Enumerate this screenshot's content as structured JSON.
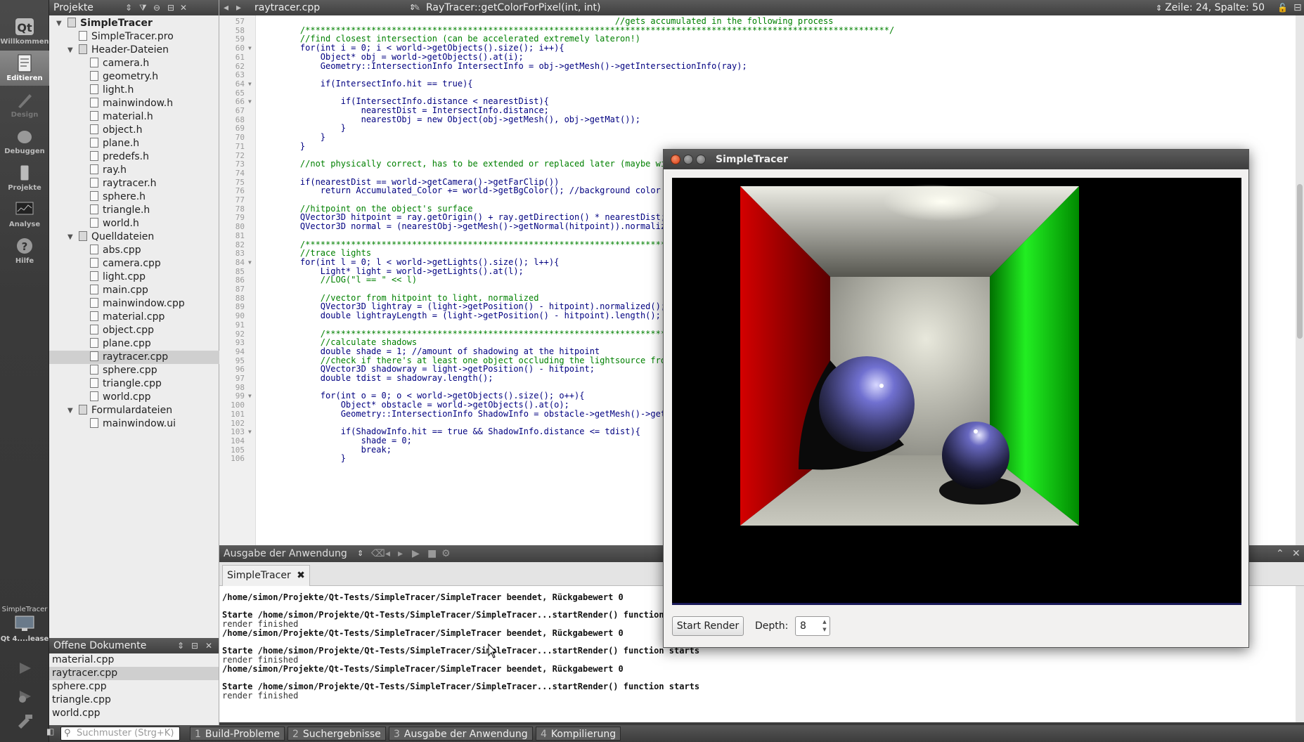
{
  "modes": [
    {
      "label": "Willkommen",
      "icon": "qt-logo-icon"
    },
    {
      "label": "Editieren",
      "icon": "edit-document-icon"
    },
    {
      "label": "Design",
      "icon": "design-pen-icon"
    },
    {
      "label": "Debuggen",
      "icon": "bug-icon"
    },
    {
      "label": "Projekte",
      "icon": "wrench-icon"
    },
    {
      "label": "Analyse",
      "icon": "monitor-icon"
    },
    {
      "label": "Hilfe",
      "icon": "help-icon"
    }
  ],
  "kit": {
    "project": "SimpleTracer",
    "label": "Qt 4....lease"
  },
  "projects_panel": {
    "title": "Projekte",
    "tree": [
      {
        "label": "SimpleTracer",
        "level": 0,
        "expanded": true,
        "bold": true
      },
      {
        "label": "SimpleTracer.pro",
        "level": 1
      },
      {
        "label": "Header-Dateien",
        "level": 1,
        "expanded": true
      },
      {
        "label": "camera.h",
        "level": 2
      },
      {
        "label": "geometry.h",
        "level": 2
      },
      {
        "label": "light.h",
        "level": 2
      },
      {
        "label": "mainwindow.h",
        "level": 2
      },
      {
        "label": "material.h",
        "level": 2
      },
      {
        "label": "object.h",
        "level": 2
      },
      {
        "label": "plane.h",
        "level": 2
      },
      {
        "label": "predefs.h",
        "level": 2
      },
      {
        "label": "ray.h",
        "level": 2
      },
      {
        "label": "raytracer.h",
        "level": 2
      },
      {
        "label": "sphere.h",
        "level": 2
      },
      {
        "label": "triangle.h",
        "level": 2
      },
      {
        "label": "world.h",
        "level": 2
      },
      {
        "label": "Quelldateien",
        "level": 1,
        "expanded": true
      },
      {
        "label": "abs.cpp",
        "level": 2
      },
      {
        "label": "camera.cpp",
        "level": 2
      },
      {
        "label": "light.cpp",
        "level": 2
      },
      {
        "label": "main.cpp",
        "level": 2
      },
      {
        "label": "mainwindow.cpp",
        "level": 2
      },
      {
        "label": "material.cpp",
        "level": 2
      },
      {
        "label": "object.cpp",
        "level": 2
      },
      {
        "label": "plane.cpp",
        "level": 2
      },
      {
        "label": "raytracer.cpp",
        "level": 2,
        "selected": true
      },
      {
        "label": "sphere.cpp",
        "level": 2
      },
      {
        "label": "triangle.cpp",
        "level": 2
      },
      {
        "label": "world.cpp",
        "level": 2
      },
      {
        "label": "Formulardateien",
        "level": 1,
        "expanded": true
      },
      {
        "label": "mainwindow.ui",
        "level": 2
      }
    ]
  },
  "open_docs": {
    "title": "Offene Dokumente",
    "items": [
      "material.cpp",
      "raytracer.cpp",
      "sphere.cpp",
      "triangle.cpp",
      "world.cpp"
    ],
    "selected": "raytracer.cpp"
  },
  "editor": {
    "file": "raytracer.cpp",
    "function": "RayTracer::getColorForPixel(int, int)",
    "position": "Zeile: 24, Spalte: 50",
    "lines": [
      {
        "n": "57",
        "t": "                                                                  //gets accumulated in the following process",
        "c": 1
      },
      {
        "n": "58",
        "t": "    /*******************************************************************************************************************/",
        "c": 1
      },
      {
        "n": "59",
        "t": "    //find closest intersection (can be accelerated extremely lateron!)",
        "c": 1
      },
      {
        "n": "60",
        "t": "    for(int i = 0; i < world->getObjects().size(); i++){",
        "f": 1
      },
      {
        "n": "61",
        "t": "        Object* obj = world->getObjects().at(i);"
      },
      {
        "n": "62",
        "t": "        Geometry::IntersectionInfo IntersectInfo = obj->getMesh()->getIntersectionInfo(ray);"
      },
      {
        "n": "63",
        "t": ""
      },
      {
        "n": "64",
        "t": "        if(IntersectInfo.hit == true){",
        "f": 1
      },
      {
        "n": "65",
        "t": ""
      },
      {
        "n": "66",
        "t": "            if(IntersectInfo.distance < nearestDist){",
        "f": 1
      },
      {
        "n": "67",
        "t": "                nearestDist = IntersectInfo.distance;"
      },
      {
        "n": "68",
        "t": "                nearestObj = new Object(obj->getMesh(), obj->getMat());"
      },
      {
        "n": "69",
        "t": "            }"
      },
      {
        "n": "70",
        "t": "        }"
      },
      {
        "n": "71",
        "t": "    }"
      },
      {
        "n": "72",
        "t": ""
      },
      {
        "n": "73",
        "t": "    //not physically correct, has to be extended or replaced later (maybe with c",
        "c": 1
      },
      {
        "n": "74",
        "t": ""
      },
      {
        "n": "75",
        "t": "    if(nearestDist == world->getCamera()->getFarClip())"
      },
      {
        "n": "76",
        "t": "        return Accumulated_Color += world->getBgColor(); //background color"
      },
      {
        "n": "77",
        "t": ""
      },
      {
        "n": "78",
        "t": "    //hitpoint on the object's surface",
        "c": 1
      },
      {
        "n": "79",
        "t": "    QVector3D hitpoint = ray.getOrigin() + ray.getDirection() * nearestDist;"
      },
      {
        "n": "80",
        "t": "    QVector3D normal = (nearestObj->getMesh()->getNormal(hitpoint)).normalized()"
      },
      {
        "n": "81",
        "t": ""
      },
      {
        "n": "82",
        "t": "    /*********************************************************************************",
        "c": 1
      },
      {
        "n": "83",
        "t": "    //trace lights",
        "c": 1
      },
      {
        "n": "84",
        "t": "    for(int l = 0; l < world->getLights().size(); l++){",
        "f": 1
      },
      {
        "n": "85",
        "t": "        Light* light = world->getLights().at(l);"
      },
      {
        "n": "86",
        "t": "        //LOG(\"l == \" << l)",
        "c": 1
      },
      {
        "n": "87",
        "t": ""
      },
      {
        "n": "88",
        "t": "        //vector from hitpoint to light, normalized",
        "c": 1
      },
      {
        "n": "89",
        "t": "        QVector3D lightray = (light->getPosition() - hitpoint).normalized();"
      },
      {
        "n": "90",
        "t": "        double lightrayLength = (light->getPosition() - hitpoint).length();"
      },
      {
        "n": "91",
        "t": ""
      },
      {
        "n": "92",
        "t": "        /*****************************************************************************",
        "c": 1
      },
      {
        "n": "93",
        "t": "        //calculate shadows",
        "c": 1
      },
      {
        "n": "94",
        "t": "        double shade = 1; //amount of shadowing at the hitpoint"
      },
      {
        "n": "95",
        "t": "        //check if there's at least one object occluding the lightsource from th",
        "c": 1
      },
      {
        "n": "96",
        "t": "        QVector3D shadowray = light->getPosition() - hitpoint;"
      },
      {
        "n": "97",
        "t": "        double tdist = shadowray.length();"
      },
      {
        "n": "98",
        "t": ""
      },
      {
        "n": "99",
        "t": "        for(int o = 0; o < world->getObjects().size(); o++){",
        "f": 1
      },
      {
        "n": "100",
        "t": "            Object* obstacle = world->getObjects().at(o);"
      },
      {
        "n": "101",
        "t": "            Geometry::IntersectionInfo ShadowInfo = obstacle->getMesh()->getInte"
      },
      {
        "n": "102",
        "t": ""
      },
      {
        "n": "103",
        "t": "            if(ShadowInfo.hit == true && ShadowInfo.distance <= tdist){",
        "f": 1
      },
      {
        "n": "104",
        "t": "                shade = 0;"
      },
      {
        "n": "105",
        "t": "                break;"
      },
      {
        "n": "106",
        "t": "            }"
      }
    ]
  },
  "output_pane": {
    "title": "Ausgabe der Anwendung",
    "tab": "SimpleTracer",
    "lines": [
      {
        "t": "/home/simon/Projekte/Qt-Tests/SimpleTracer/SimpleTracer beendet, Rückgabewert 0",
        "b": 1
      },
      {
        "t": ""
      },
      {
        "t": "Starte /home/simon/Projekte/Qt-Tests/SimpleTracer/SimpleTracer...startRender() function starts",
        "b": 1
      },
      {
        "t": "render finished"
      },
      {
        "t": "/home/simon/Projekte/Qt-Tests/SimpleTracer/SimpleTracer beendet, Rückgabewert 0",
        "b": 1
      },
      {
        "t": ""
      },
      {
        "t": "Starte /home/simon/Projekte/Qt-Tests/SimpleTracer/SimpleTracer...startRender() function starts",
        "b": 1
      },
      {
        "t": "render finished"
      },
      {
        "t": "/home/simon/Projekte/Qt-Tests/SimpleTracer/SimpleTracer beendet, Rückgabewert 0",
        "b": 1
      },
      {
        "t": ""
      },
      {
        "t": "Starte /home/simon/Projekte/Qt-Tests/SimpleTracer/SimpleTracer...startRender() function starts",
        "b": 1
      },
      {
        "t": "render finished"
      }
    ]
  },
  "bottom_bar": {
    "search_placeholder": "Suchmuster (Strg+K)",
    "tabs": [
      {
        "num": "1",
        "label": "Build-Probleme"
      },
      {
        "num": "2",
        "label": "Suchergebnisse"
      },
      {
        "num": "3",
        "label": "Ausgabe der Anwendung"
      },
      {
        "num": "4",
        "label": "Kompilierung"
      }
    ]
  },
  "app_window": {
    "title": "SimpleTracer",
    "start_button": "Start Render",
    "depth_label": "Depth:",
    "depth_value": "8"
  },
  "colors": {
    "accent_close": "#e8552b",
    "red_wall": "#b00000",
    "green_wall": "#00b000"
  }
}
